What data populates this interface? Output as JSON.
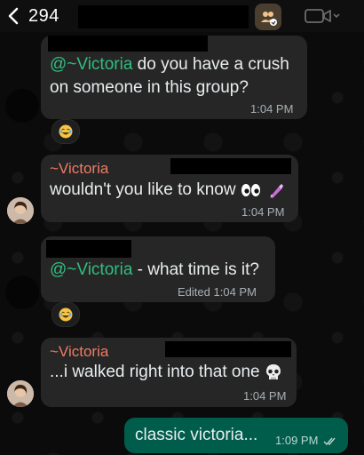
{
  "header": {
    "back_count": "294",
    "icons": {
      "back": "chevron-left-icon",
      "group": "group-avatar-icon",
      "video": "video-call-icon"
    }
  },
  "messages": [
    {
      "id": "m1",
      "mention": "@~Victoria",
      "text_a": " do you have a crush",
      "text_b": "on someone in this group?",
      "time": "1:04 PM",
      "reaction": "laughing-emoji-icon"
    },
    {
      "id": "m2",
      "sender": "~Victoria",
      "text": "wouldn't you like to know",
      "emoji": [
        "eyes-emoji-icon",
        "nail-polish-emoji-icon"
      ],
      "time": "1:04 PM"
    },
    {
      "id": "m3",
      "mention": "@~Victoria",
      "text": " - what time is it?",
      "edited": "Edited",
      "time": "1:04 PM",
      "reaction": "laughing-emoji-icon"
    },
    {
      "id": "m4",
      "sender": "~Victoria",
      "text": "...i walked right into that one",
      "emoji": [
        "skull-emoji-icon"
      ],
      "time": "1:04 PM"
    },
    {
      "id": "m5",
      "text": "classic victoria...",
      "time": "1:09 PM",
      "status": "read-double-check-icon"
    }
  ],
  "colors": {
    "bubble_in": "#262626",
    "bubble_out": "#005c4b",
    "mention": "#2fbf7f",
    "sender": "#f07c63"
  }
}
